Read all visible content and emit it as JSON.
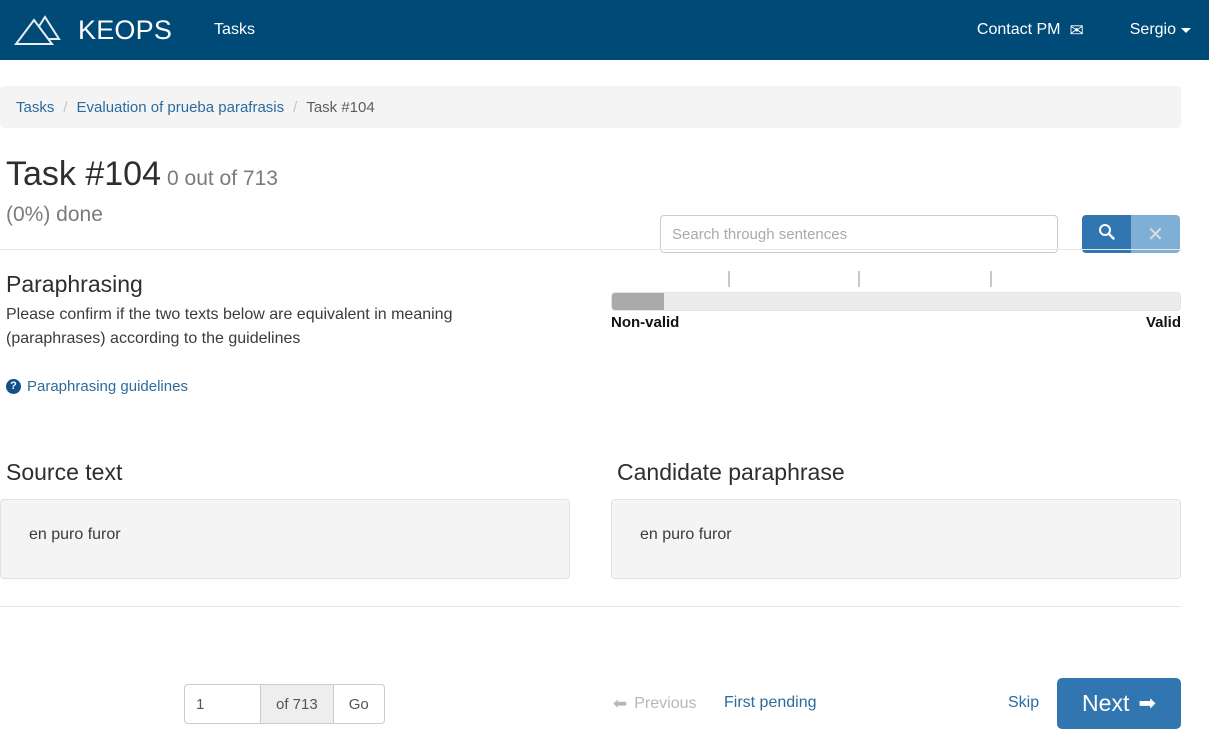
{
  "navbar": {
    "logo_icon": "pyramids-logo-icon",
    "brand": "KEOPS",
    "tasks_link": "Tasks",
    "contact_pm": "Contact PM",
    "envelope_icon": "envelope-icon",
    "user": "Sergio",
    "brand_color": "#004a77"
  },
  "breadcrumb": {
    "tasks": "Tasks",
    "sep1": "/",
    "evaluation": "Evaluation of prueba parafrasis",
    "sep2": "/",
    "current": "Task #104"
  },
  "header": {
    "title": "Task #104",
    "progress_text": "0 out of 713",
    "done_text": "(0%) done"
  },
  "search": {
    "placeholder": "Search through sentences",
    "value": "",
    "search_icon": "magnifier-icon",
    "clear_icon": "close-x-icon",
    "search_button_color": "#3276b1",
    "clear_button_color": "#7fafd4"
  },
  "task": {
    "heading": "Paraphrasing",
    "description": "Please confirm if the two texts below are equivalent in meaning (paraphrases) according to the guidelines",
    "guidelines_link": "Paraphrasing guidelines",
    "guidelines_icon": "question-circle-icon"
  },
  "slider": {
    "label_left": "Non-valid",
    "label_right": "Valid",
    "value_percent": 0,
    "handle_width_percent": 9,
    "tick_percents": [
      20.5,
      43.3,
      66.5
    ],
    "track_color": "#ececec",
    "handle_color": "#aaaaaa"
  },
  "panels": {
    "left": {
      "heading": "Source text",
      "text": "en puro furor"
    },
    "right": {
      "heading": "Candidate paraphrase",
      "text": "en puro furor"
    }
  },
  "footer": {
    "page_value": "1",
    "page_placeholder": "1",
    "of_total": "of 713",
    "go_label": "Go",
    "previous_label": "Previous",
    "previous_arrow": "left-arrow-icon",
    "first_pending_label": "First pending",
    "skip_label": "Skip",
    "next_label": "Next",
    "next_arrow": "right-arrow-icon",
    "next_color": "#3276b1"
  }
}
